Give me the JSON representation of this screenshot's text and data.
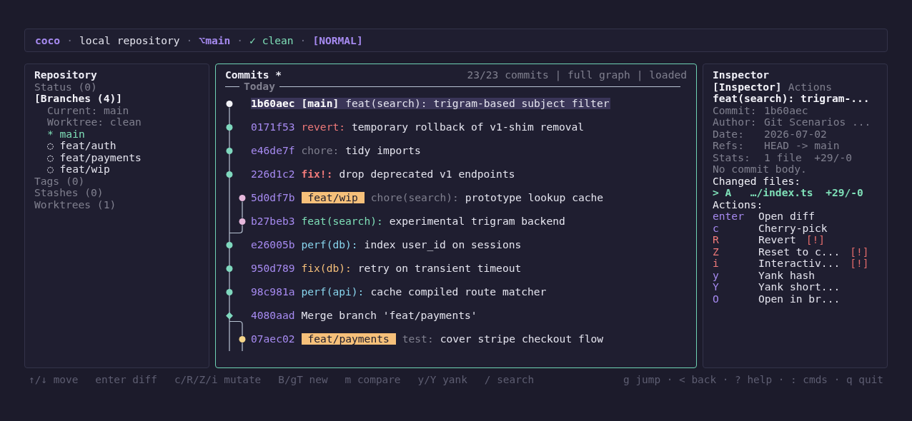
{
  "header": {
    "separator": "·",
    "segments": [
      {
        "kind": "app",
        "text": "coco"
      },
      {
        "kind": "repo",
        "text": "local repository"
      },
      {
        "kind": "branch",
        "glyph": "⌥",
        "text": "main"
      },
      {
        "kind": "status",
        "text": "✓ clean"
      },
      {
        "kind": "mode",
        "text": "[NORMAL]"
      }
    ]
  },
  "sidebar": {
    "title": "Repository",
    "sections": [
      {
        "label": "Status (0)",
        "selected": false
      },
      {
        "label": "[Branches (4)]",
        "selected": true,
        "info": [
          "Current: main",
          "Worktree: clean"
        ],
        "branches": [
          {
            "marker": "*",
            "name": "main",
            "current": true
          },
          {
            "marker": "◌",
            "name": "feat/auth",
            "current": false
          },
          {
            "marker": "◌",
            "name": "feat/payments",
            "current": false
          },
          {
            "marker": "◌",
            "name": "feat/wip",
            "current": false
          }
        ]
      },
      {
        "label": "Tags (0)",
        "selected": false
      },
      {
        "label": "Stashes (0)",
        "selected": false
      },
      {
        "label": "Worktrees (1)",
        "selected": false
      }
    ]
  },
  "commits": {
    "title": "Commits *",
    "summary": "23/23 commits | full graph | loaded",
    "group": "Today",
    "rows": [
      {
        "kind": "commit",
        "hash": "1b60aec",
        "ref": "[main]",
        "type": {
          "kind": "normal",
          "text": "feat(search):"
        },
        "subject": "trigram-based subject filter",
        "side_branch": false,
        "color": "#f2f2f7",
        "selected": true
      },
      {
        "kind": "commit",
        "hash": "0171f53",
        "type": {
          "kind": "normal",
          "text": "revert:",
          "color": "#f07a7a"
        },
        "subject": "temporary rollback of v1-shim removal",
        "side_branch": false,
        "color": "#7fd8be",
        "selected": false
      },
      {
        "kind": "commit",
        "hash": "e46de7f",
        "type": {
          "kind": "normal",
          "text": "chore:",
          "color": "#80808f"
        },
        "subject": "tidy imports",
        "side_branch": false,
        "color": "#7fd8be",
        "selected": false
      },
      {
        "kind": "commit",
        "hash": "226d1c2",
        "type": {
          "kind": "strong",
          "text": "fix!:",
          "color": "#f07a7a"
        },
        "subject": "drop deprecated v1 endpoints",
        "side_branch": false,
        "color": "#7fd8be",
        "selected": false
      },
      {
        "kind": "commit",
        "hash": "5d0df7b",
        "tag": "feat/wip",
        "type": {
          "kind": "normal",
          "text": "chore(search):",
          "color": "#80808f"
        },
        "subject": "prototype lookup cache",
        "side_branch": true,
        "color": "#e6b8dc",
        "selected": false
      },
      {
        "kind": "commit",
        "hash": "b27beb3",
        "type": {
          "kind": "normal",
          "text": "feat(search):",
          "color": "#7fe0b8"
        },
        "subject": "experimental trigram backend",
        "side_branch": true,
        "color": "#e6b8dc",
        "selected": false
      },
      {
        "kind": "commit",
        "hash": "e26005b",
        "type": {
          "kind": "normal",
          "text": "perf(db):",
          "color": "#89d6ee"
        },
        "subject": "index user_id on sessions",
        "side_branch": false,
        "color": "#7fd8be",
        "selected": false
      },
      {
        "kind": "commit",
        "hash": "950d789",
        "type": {
          "kind": "normal",
          "text": "fix(db):",
          "color": "#f6c07a"
        },
        "subject": "retry on transient timeout",
        "side_branch": false,
        "color": "#7fd8be",
        "selected": false
      },
      {
        "kind": "commit",
        "hash": "98c981a",
        "type": {
          "kind": "normal",
          "text": "perf(api):",
          "color": "#89d6ee"
        },
        "subject": "cache compiled route matcher",
        "side_branch": false,
        "color": "#7fd8be",
        "selected": false
      },
      {
        "kind": "merge",
        "hash": "4080aad",
        "subject": "Merge branch 'feat/payments'",
        "side_branch": false,
        "color": "#7fd8be",
        "selected": false
      },
      {
        "kind": "commit",
        "hash": "07aec02",
        "tag": "feat/payments",
        "type": {
          "kind": "normal",
          "text": "test:",
          "color": "#80808f"
        },
        "subject": "cover stripe checkout flow",
        "side_branch": true,
        "color": "#f5d58a",
        "selected": false
      }
    ]
  },
  "inspector": {
    "title": "Inspector",
    "tabs": [
      {
        "label": "[Inspector]",
        "selected": true
      },
      {
        "label": "Actions",
        "selected": false
      }
    ],
    "subject": "feat(search): trigram-...",
    "fields": [
      {
        "label": "Commit:",
        "value": "1b60aec"
      },
      {
        "label": "Author:",
        "value": "Git Scenarios ..."
      },
      {
        "label": "Date:",
        "value": "2026-07-02"
      },
      {
        "label": "Refs:",
        "value": "HEAD -> main"
      },
      {
        "label": "Stats:",
        "value": "1 file  +29/-0"
      }
    ],
    "body": "No commit body.",
    "files_label": "Changed files:",
    "files": [
      {
        "text": "> A   …/index.ts  +29/-0",
        "selected": true
      }
    ],
    "actions_label": "Actions:",
    "actions": [
      {
        "key": "enter",
        "label": "Open diff",
        "kind": "safe"
      },
      {
        "key": "c",
        "label": "Cherry-pick",
        "kind": "safe"
      },
      {
        "key": "R",
        "label": "Revert",
        "kind": "danger",
        "flag": "[!]"
      },
      {
        "key": "Z",
        "label": "Reset to c...",
        "kind": "danger",
        "flag": "[!]"
      },
      {
        "key": "i",
        "label": "Interactiv...",
        "kind": "danger",
        "flag": "[!]"
      },
      {
        "key": "y",
        "label": "Yank hash",
        "kind": "safe"
      },
      {
        "key": "Y",
        "label": "Yank short...",
        "kind": "safe"
      },
      {
        "key": "O",
        "label": "Open in br...",
        "kind": "safe"
      }
    ]
  },
  "footer": {
    "hints": [
      "↑/↓ move",
      "enter diff",
      "c/R/Z/i mutate",
      "B/gT new",
      "m compare",
      "y/Y yank",
      "/ search"
    ],
    "nav": "g jump · < back · ? help · : cmds · q quit"
  }
}
